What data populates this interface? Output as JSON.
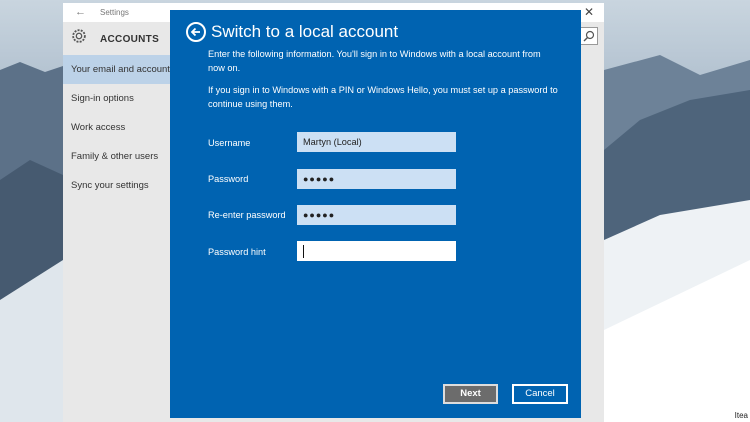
{
  "settings_window": {
    "title": "Settings",
    "header": "ACCOUNTS",
    "nav": [
      "Your email and accounts",
      "Sign-in options",
      "Work access",
      "Family & other users",
      "Sync your settings"
    ]
  },
  "dialog": {
    "title": "Switch to a local account",
    "description": "Enter the following information. You'll sign in to Windows with a local account from now on.",
    "note": "If you sign in to Windows with a PIN or Windows Hello, you must set up a password to continue using them.",
    "fields": {
      "username": {
        "label": "Username",
        "value": "Martyn (Local)"
      },
      "password": {
        "label": "Password",
        "value": "●●●●●"
      },
      "reenter": {
        "label": "Re-enter password",
        "value": "●●●●●"
      },
      "hint": {
        "label": "Password hint",
        "value": ""
      }
    },
    "buttons": {
      "next": "Next",
      "cancel": "Cancel"
    }
  },
  "corner_text": "Itea",
  "colors": {
    "dialog_bg": "#0063b1",
    "field_bg": "#cce0f4",
    "nav_active": "#bcd2e8",
    "next_button": "#6c6c6c"
  },
  "icons": [
    "back-arrow-icon",
    "gear-icon",
    "search-icon",
    "close-icon",
    "back-circle-icon"
  ]
}
